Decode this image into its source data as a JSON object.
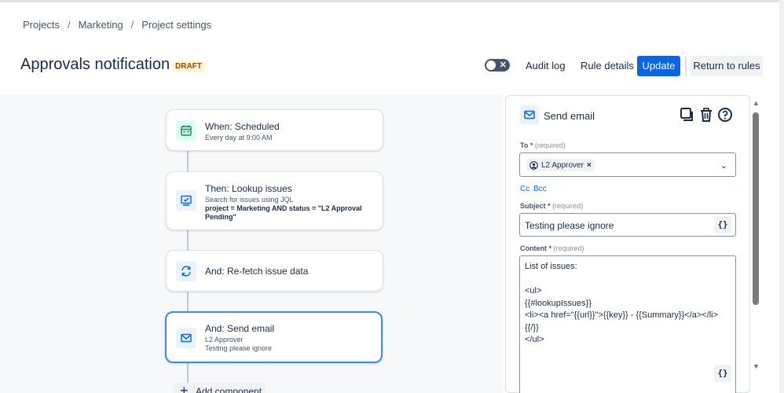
{
  "breadcrumb": {
    "items": [
      "Projects",
      "Marketing",
      "Project settings"
    ],
    "separator": "/"
  },
  "header": {
    "title": "Approvals notification",
    "status_badge": "DRAFT",
    "toggle_x": "✕",
    "audit_log": "Audit log",
    "rule_details": "Rule details",
    "update": "Update",
    "return_to_rules": "Return to rules"
  },
  "flow": {
    "nodes": [
      {
        "label": "When: Scheduled",
        "sub": "Every day at 9:00 AM",
        "icon": "calendar-icon"
      },
      {
        "label": "Then: Lookup issues",
        "sub_line1": "Search for issues using JQL",
        "sub_bold": "project = Marketing AND status = \"L2 Approval Pending\"",
        "icon": "lookup-issues-icon"
      },
      {
        "label": "And: Re-fetch issue data",
        "icon": "refresh-icon"
      },
      {
        "label": "And: Send email",
        "sub_line1": "L2 Approver",
        "sub_line2": "Testing please ignore",
        "icon": "email-icon"
      }
    ],
    "add_component": "Add component"
  },
  "panel": {
    "title": "Send email",
    "to_label": "To",
    "required_marker": "*",
    "required_hint": "(required)",
    "to_chip": "L2 Approver",
    "chip_remove": "×",
    "chevron": "⌄",
    "cc": "Cc",
    "bcc": "Bcc",
    "subject_label": "Subject",
    "subject_value": "Testing please ignore",
    "content_label": "Content",
    "content_value": "List of issues:\n\n<ul>\n{{#lookupIssues}}\n<li><a href=\"{{url}}\">{{key}} - {{Summary}}</a></li>\n{{/}}\n</ul>",
    "brace_button": "{}"
  },
  "colors": {
    "primary": "#0c66e4",
    "draft_text": "#a54800",
    "draft_bg": "#fff7d6",
    "selected_border": "#388bff"
  }
}
